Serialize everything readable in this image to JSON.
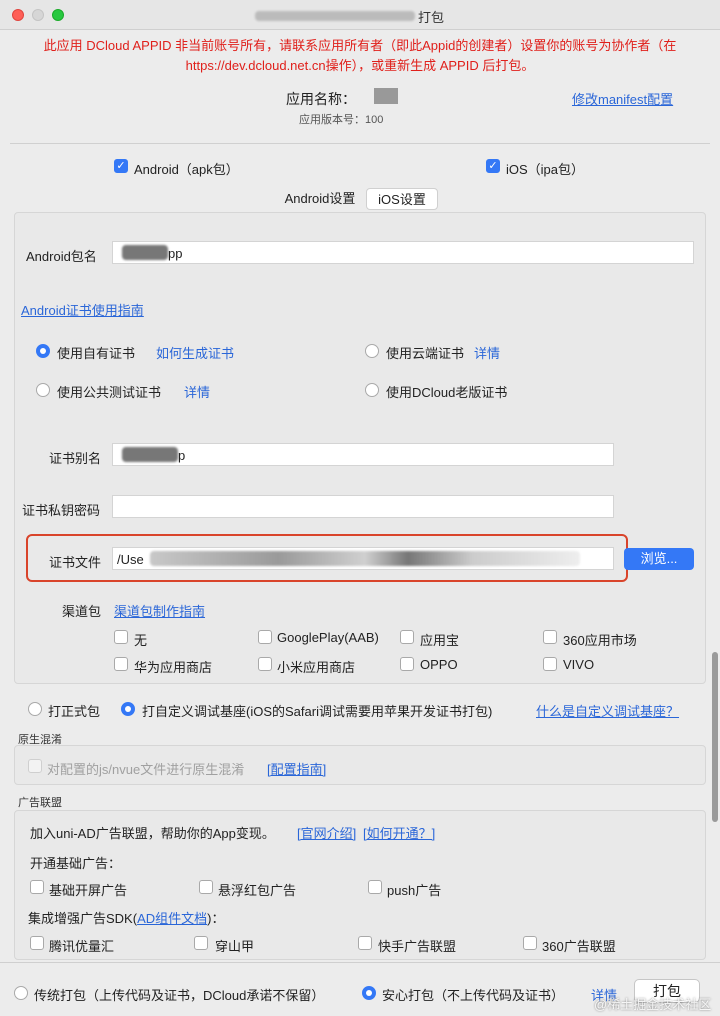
{
  "window": {
    "title_suffix": "打包"
  },
  "warning": {
    "line1": "此应用 DCloud APPID 非当前账号所有，请联系应用所有者（即此Appid的创建者）设置你的账号为协作者（在",
    "line2": "https://dev.dcloud.net.cn操作），或重新生成 APPID 后打包。"
  },
  "app": {
    "name_label": "应用名称：",
    "version_label": "应用版本号：100",
    "edit_manifest": "修改manifest配置"
  },
  "platforms": {
    "android": {
      "label": "Android（apk包）",
      "checked": true
    },
    "ios": {
      "label": "iOS（ipa包）",
      "checked": true
    }
  },
  "tabs": [
    "Android设置",
    "iOS设置"
  ],
  "android": {
    "package_label": "Android包名",
    "package_value": "pp",
    "cert_guide": "Android证书使用指南",
    "cert_options": [
      {
        "label": "使用自有证书",
        "checked": true,
        "link": "如何生成证书"
      },
      {
        "label": "使用云端证书",
        "checked": false,
        "link": "详情"
      },
      {
        "label": "使用公共测试证书",
        "checked": false,
        "link": "详情"
      },
      {
        "label": "使用DCloud老版证书",
        "checked": false,
        "link": ""
      }
    ],
    "alias_label": "证书别名",
    "alias_value": "p",
    "password_label": "证书私钥密码",
    "password_value": "",
    "file_label": "证书文件",
    "file_value": "/Use",
    "browse": "浏览...",
    "highlight_color": "#d9442b",
    "channel_label": "渠道包",
    "channel_guide": "渠道包制作指南",
    "channels": [
      "无",
      "GooglePlay(AAB)",
      "应用宝",
      "360应用市场",
      "华为应用商店",
      "小米应用商店",
      "OPPO",
      "VIVO"
    ]
  },
  "build_mode": {
    "normal": "打正式包",
    "custom": "打自定义调试基座(iOS的Safari调试需要用苹果开发证书打包)",
    "custom_link": "什么是自定义调试基座？"
  },
  "obfuscation": {
    "section": "原生混淆",
    "label": "对配置的js/nvue文件进行原生混淆",
    "link": "[配置指南]"
  },
  "ads": {
    "section": "广告联盟",
    "intro": "加入uni-AD广告联盟，帮助你的App变现。",
    "intro_link1": "[官网介绍]",
    "intro_link2": "[如何开通？]",
    "basic_title": "开通基础广告：",
    "basic": [
      "基础开屏广告",
      "悬浮红包广告",
      "push广告"
    ],
    "sdk_title_pre": "集成增强广告SDK(",
    "sdk_title_link": "AD组件文档",
    "sdk_title_post": ")：",
    "sdk": [
      "腾讯优量汇",
      "穿山甲",
      "快手广告联盟",
      "360广告联盟"
    ]
  },
  "footer": {
    "traditional": "传统打包（上传代码及证书，DCloud承诺不保留）",
    "safe": "安心打包（不上传代码及证书）",
    "detail": "详情",
    "pack": "打包",
    "watermark": "@稀土掘金技术社区"
  }
}
